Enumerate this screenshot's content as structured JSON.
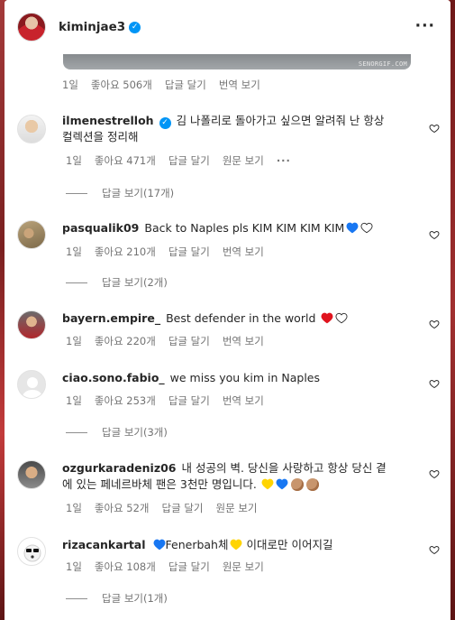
{
  "header": {
    "username": "kiminjae3",
    "verified_mark": "✓",
    "more_icon": "···"
  },
  "post_meta": {
    "time": "1일",
    "likes": "좋아요 506개",
    "reply": "답글 달기",
    "translate": "번역 보기"
  },
  "post_image": {
    "watermark": "SENORGIF.COM"
  },
  "comments": [
    {
      "username": "ilmenestrelloh",
      "verified": true,
      "text_line1": "김 나폴리로 돌아가고 싶으면 알려줘 난 항상",
      "text_line2": "컬렉션을 정리해",
      "time": "1일",
      "likes": "좋아요 471개",
      "reply": "답글 달기",
      "action": "원문 보기",
      "more": "···",
      "replies": "답글 보기(17개)"
    },
    {
      "username": "pasqualik09",
      "text": "Back to Naples pls KIM KIM KIM KIM",
      "time": "1일",
      "likes": "좋아요 210개",
      "reply": "답글 달기",
      "action": "번역 보기",
      "replies": "답글 보기(2개)"
    },
    {
      "username": "bayern.empire_",
      "text": "Best defender in the world",
      "time": "1일",
      "likes": "좋아요 220개",
      "reply": "답글 달기",
      "action": "번역 보기"
    },
    {
      "username": "ciao.sono.fabio_",
      "text": "we miss you kim in Naples",
      "time": "1일",
      "likes": "좋아요 253개",
      "reply": "답글 달기",
      "action": "번역 보기",
      "replies": "답글 보기(3개)"
    },
    {
      "username": "ozgurkaradeniz06",
      "text_line1": "내 성공의 벽. 당신을 사랑하고 항상 당신 곁",
      "text_line2": "에 있는 페네르바체 팬은 3천만 명입니다.",
      "time": "1일",
      "likes": "좋아요 52개",
      "reply": "답글 달기",
      "action": "원문 보기"
    },
    {
      "username": "rizacankartal",
      "text_a": "Fenerbah체",
      "text_b": "이대로만 이어지길",
      "time": "1일",
      "likes": "좋아요 108개",
      "reply": "답글 달기",
      "action": "원문 보기",
      "replies": "답글 보기(1개)"
    }
  ],
  "colors": {
    "verified": "#0095f6",
    "blue_heart": "#1877f2",
    "red_heart": "#e0141e",
    "yellow_heart": "#ffd400",
    "meta_text": "#737373"
  },
  "icons": {
    "heart_outline": "heart-outline-icon",
    "more": "more-options-icon"
  }
}
